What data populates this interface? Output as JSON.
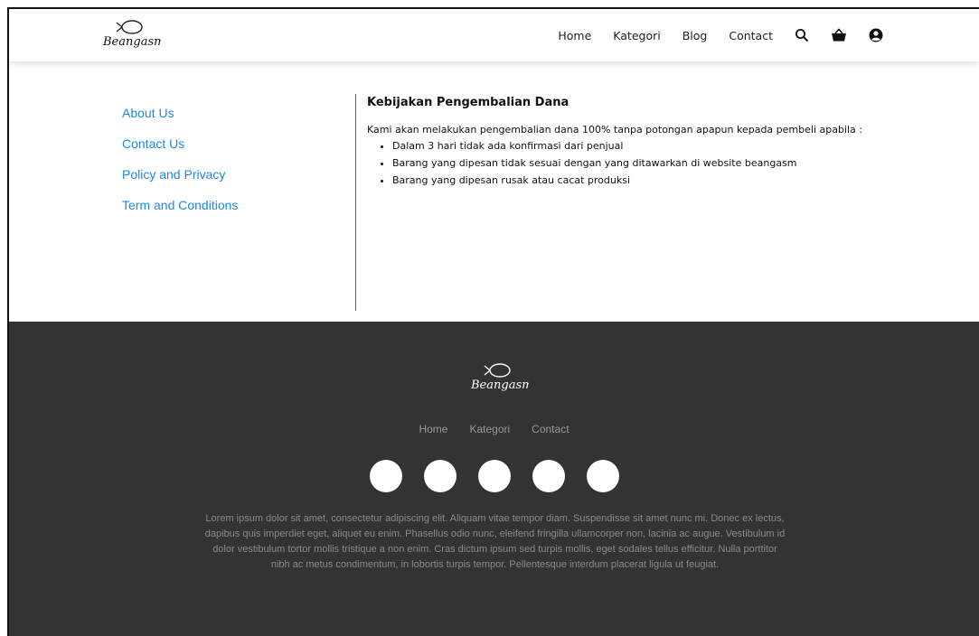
{
  "header": {
    "logo_text": "Beangasm",
    "nav": [
      "Home",
      "Kategori",
      "Blog",
      "Contact"
    ],
    "icons": [
      "search-icon",
      "basket-icon",
      "user-icon"
    ]
  },
  "sidebar": {
    "items": [
      "About Us",
      "Contact Us",
      "Policy and Privacy",
      "Term and Conditions"
    ]
  },
  "article": {
    "title": "Kebijakan Pengembalian Dana",
    "intro": "Kami akan melakukan pengembalian dana 100% tanpa potongan apapun kepada pembeli apabila :",
    "bullets": [
      "Dalam 3 hari tidak ada konfirmasi dari penjual",
      "Barang yang dipesan tidak sesuai dengan yang ditawarkan di website beangasm",
      "Barang yang dipesan rusak atau cacat produksi"
    ]
  },
  "footer": {
    "logo_text": "Beangasm",
    "links": [
      "Home",
      "Kategori",
      "Contact"
    ],
    "social_count": 5,
    "text": "Lorem ipsum dolor sit amet, consectetur adipiscing elit. Aliquam vitae tempor diam. Suspendisse sit amet nunc mi. Donec ex lectus, dapibus quis imperdiet eget, aliquet eu enim. Phasellus odio nunc, eleifend fringilla ullamcorper non, lacinia ac augue. Vestibulum id dolor vestibulum tortor mollis tristique a non enim. Cras dictum ipsum sed turpis mollis, eget sodales tellus efficitur. Nulla porttitor nibh ac metus condimentum, in lobortis turpis tempor. Pellentesque interdum placerat ligula ut feugiat."
  },
  "colors": {
    "link_blue": "#1e88e5",
    "footer_bg": "#333333",
    "footer_text": "#8a8a8a"
  }
}
